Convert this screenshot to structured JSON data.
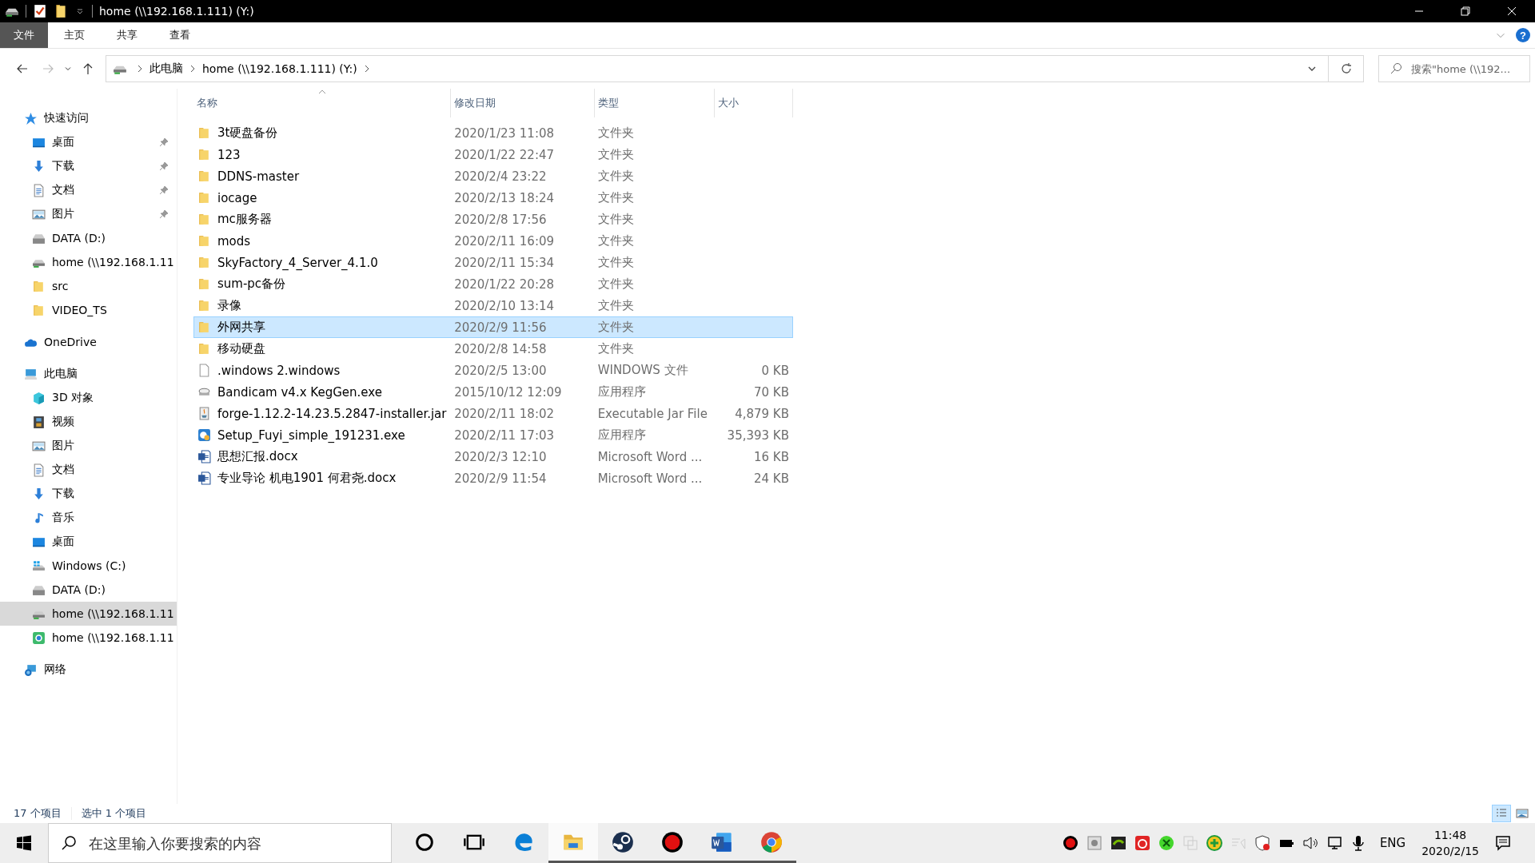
{
  "title_bar": {
    "title": "home (\\\\192.168.1.111) (Y:)"
  },
  "ribbon": {
    "help": "?",
    "tabs": [
      {
        "label": "文件",
        "kind": "file",
        "selected": false
      },
      {
        "label": "主页",
        "kind": "tab",
        "selected": false
      },
      {
        "label": "共享",
        "kind": "tab",
        "selected": false
      },
      {
        "label": "查看",
        "kind": "tab",
        "selected": false
      }
    ]
  },
  "address_bar": {
    "crumbs": [
      "此电脑",
      "home (\\\\192.168.1.111) (Y:)"
    ],
    "search_placeholder": "搜索\"home (\\\\192..."
  },
  "sidebar": {
    "groups": [
      {
        "label": "快速访问",
        "kind": "star",
        "children": [
          {
            "label": "桌面",
            "kind": "desktop",
            "pinned": true,
            "selected": false
          },
          {
            "label": "下载",
            "kind": "download",
            "pinned": true,
            "selected": false
          },
          {
            "label": "文档",
            "kind": "document",
            "pinned": true,
            "selected": false
          },
          {
            "label": "图片",
            "kind": "picture",
            "pinned": true,
            "selected": false
          },
          {
            "label": "DATA (D:)",
            "kind": "drive",
            "pinned": false,
            "selected": false
          },
          {
            "label": "home (\\\\192.168.1.11",
            "kind": "netdrive",
            "pinned": false,
            "selected": false
          },
          {
            "label": "src",
            "kind": "folder",
            "pinned": false,
            "selected": false
          },
          {
            "label": "VIDEO_TS",
            "kind": "folder",
            "pinned": false,
            "selected": false
          }
        ]
      },
      {
        "label": "OneDrive",
        "kind": "cloud"
      },
      {
        "label": "此电脑",
        "kind": "pc",
        "children": [
          {
            "label": "3D 对象",
            "kind": "cube",
            "pinned": false,
            "selected": false
          },
          {
            "label": "视频",
            "kind": "video",
            "pinned": false,
            "selected": false
          },
          {
            "label": "图片",
            "kind": "picture",
            "pinned": false,
            "selected": false
          },
          {
            "label": "文档",
            "kind": "document",
            "pinned": false,
            "selected": false
          },
          {
            "label": "下载",
            "kind": "download",
            "pinned": false,
            "selected": false
          },
          {
            "label": "音乐",
            "kind": "music",
            "pinned": false,
            "selected": false
          },
          {
            "label": "桌面",
            "kind": "desktop",
            "pinned": false,
            "selected": false
          },
          {
            "label": "Windows (C:)",
            "kind": "windrive",
            "pinned": false,
            "selected": false
          },
          {
            "label": "DATA (D:)",
            "kind": "drive",
            "pinned": false,
            "selected": false
          },
          {
            "label": "home (\\\\192.168.1.11",
            "kind": "netdrive",
            "pinned": false,
            "selected": true
          },
          {
            "label": "home (\\\\192.168.1.11",
            "kind": "webdrive",
            "pinned": false,
            "selected": false
          }
        ]
      },
      {
        "label": "网络",
        "kind": "network"
      }
    ]
  },
  "table": {
    "columns": [
      {
        "label": "名称",
        "sorted": true
      },
      {
        "label": "修改日期",
        "sorted": false
      },
      {
        "label": "类型",
        "sorted": false
      },
      {
        "label": "大小",
        "sorted": false
      }
    ],
    "rows": [
      {
        "kind": "folder",
        "name": "3t硬盘备份",
        "date": "2020/1/23 11:08",
        "type": "文件夹",
        "selected": false
      },
      {
        "kind": "folder",
        "name": "123",
        "date": "2020/1/22 22:47",
        "type": "文件夹",
        "selected": false
      },
      {
        "kind": "folder",
        "name": "DDNS-master",
        "date": "2020/2/4 23:22",
        "type": "文件夹",
        "selected": false
      },
      {
        "kind": "folder",
        "name": "iocage",
        "date": "2020/2/13 18:24",
        "type": "文件夹",
        "selected": false
      },
      {
        "kind": "folder",
        "name": "mc服务器",
        "date": "2020/2/8 17:56",
        "type": "文件夹",
        "selected": false
      },
      {
        "kind": "folder",
        "name": "mods",
        "date": "2020/2/11 16:09",
        "type": "文件夹",
        "selected": false
      },
      {
        "kind": "folder",
        "name": "SkyFactory_4_Server_4.1.0",
        "date": "2020/2/11 15:34",
        "type": "文件夹",
        "selected": false
      },
      {
        "kind": "folder",
        "name": "sum-pc备份",
        "date": "2020/1/22 20:28",
        "type": "文件夹",
        "selected": false
      },
      {
        "kind": "folder",
        "name": "录像",
        "date": "2020/2/10 13:14",
        "type": "文件夹",
        "selected": false
      },
      {
        "kind": "folder",
        "name": "外网共享",
        "date": "2020/2/9 11:56",
        "type": "文件夹",
        "selected": true
      },
      {
        "kind": "folder",
        "name": "移动硬盘",
        "date": "2020/2/8 14:58",
        "type": "文件夹",
        "selected": false
      },
      {
        "kind": "blank",
        "name": ".windows 2.windows",
        "date": "2020/2/5 13:00",
        "type": "WINDOWS 文件",
        "size": "0 KB",
        "selected": false
      },
      {
        "kind": "exe",
        "name": "Bandicam v4.x KegGen.exe",
        "date": "2015/10/12 12:09",
        "type": "应用程序",
        "size": "70 KB",
        "selected": false
      },
      {
        "kind": "jar",
        "name": "forge-1.12.2-14.23.5.2847-installer.jar",
        "date": "2020/2/11 18:02",
        "type": "Executable Jar File",
        "size": "4,879 KB",
        "selected": false
      },
      {
        "kind": "setup",
        "name": "Setup_Fuyi_simple_191231.exe",
        "date": "2020/2/11 17:03",
        "type": "应用程序",
        "size": "35,393 KB",
        "selected": false
      },
      {
        "kind": "word",
        "name": "思想汇报.docx",
        "date": "2020/2/3 12:10",
        "type": "Microsoft Word ...",
        "size": "16 KB",
        "selected": false
      },
      {
        "kind": "word",
        "name": "专业导论  机电1901 何君尧.docx",
        "date": "2020/2/9 11:54",
        "type": "Microsoft Word ...",
        "size": "24 KB",
        "selected": false
      }
    ]
  },
  "status_bar": {
    "count": "17 个项目",
    "selection": "选中 1 个项目",
    "views": [
      {
        "kind": "details",
        "selected": true
      },
      {
        "kind": "thumbnails",
        "selected": false
      }
    ]
  },
  "taskbar": {
    "search_placeholder": "在这里输入你要搜索的内容",
    "apps": [
      {
        "kind": "cortana",
        "running": false,
        "selected": false
      },
      {
        "kind": "taskview",
        "running": false,
        "selected": false
      },
      {
        "kind": "edge",
        "running": false,
        "selected": false
      },
      {
        "kind": "explorer",
        "running": true,
        "selected": true
      },
      {
        "kind": "steam",
        "running": true,
        "selected": false
      },
      {
        "kind": "recorder",
        "running": true,
        "selected": false
      },
      {
        "kind": "word",
        "running": true,
        "selected": false
      },
      {
        "kind": "chrome",
        "running": true,
        "selected": false
      }
    ],
    "language": "ENG",
    "time": "11:48",
    "date": "2020/2/15"
  }
}
